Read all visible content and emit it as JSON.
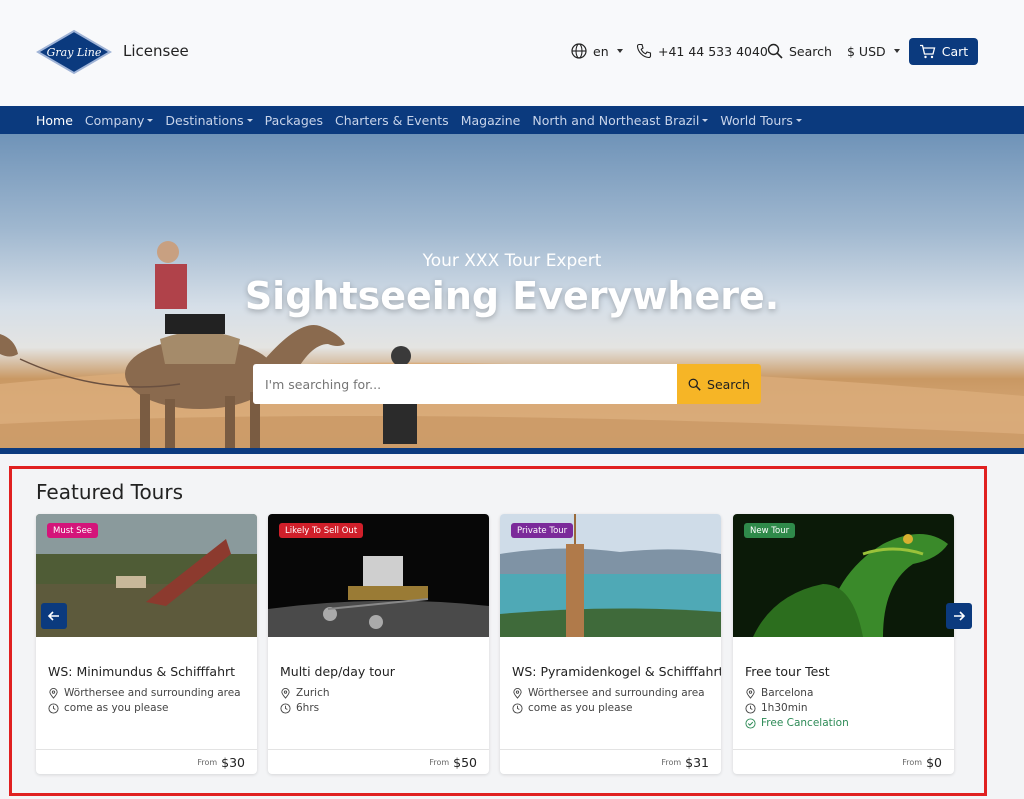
{
  "header": {
    "brand": "Gray Line",
    "brand_suffix": "Licensee",
    "language": "en",
    "phone": "+41 44 533 4040",
    "search_label": "Search",
    "currency": "$ USD",
    "cart_label": "Cart"
  },
  "nav": {
    "items": [
      {
        "label": "Home"
      },
      {
        "label": "Company"
      },
      {
        "label": "Destinations"
      },
      {
        "label": "Packages"
      },
      {
        "label": "Charters & Events"
      },
      {
        "label": "Magazine"
      },
      {
        "label": "North and Northeast Brazil"
      },
      {
        "label": "World Tours"
      }
    ]
  },
  "hero": {
    "subtitle": "Your XXX Tour Expert",
    "title": "Sightseeing Everywhere.",
    "search_placeholder": "I'm searching for...",
    "search_button": "Search"
  },
  "featured": {
    "title": "Featured Tours",
    "cards": [
      {
        "badge": "Must See",
        "badge_color": "#d4147a",
        "title": "WS: Minimundus & Schifffahrt",
        "location": "Wörthersee and surrounding area",
        "duration": "come as you please",
        "from": "From",
        "price": "$30"
      },
      {
        "badge": "Likely To Sell Out",
        "badge_color": "#d01f2a",
        "title": "Multi dep/day tour",
        "location": "Zurich",
        "duration": "6hrs",
        "from": "From",
        "price": "$50"
      },
      {
        "badge": "Private Tour",
        "badge_color": "#7b2a9a",
        "title": "WS: Pyramidenkogel & Schifffahrt",
        "location": "Wörthersee and surrounding area",
        "duration": "come as you please",
        "from": "From",
        "price": "$31"
      },
      {
        "badge": "New Tour",
        "badge_color": "#2f8a4a",
        "title": "Free tour Test",
        "location": "Barcelona",
        "duration": "1h30min",
        "extra": "Free Cancelation",
        "from": "From",
        "price": "$0"
      }
    ]
  },
  "colors": {
    "primary": "#0b3a7e",
    "accent": "#f6b526",
    "highlight_border": "#e02020"
  }
}
